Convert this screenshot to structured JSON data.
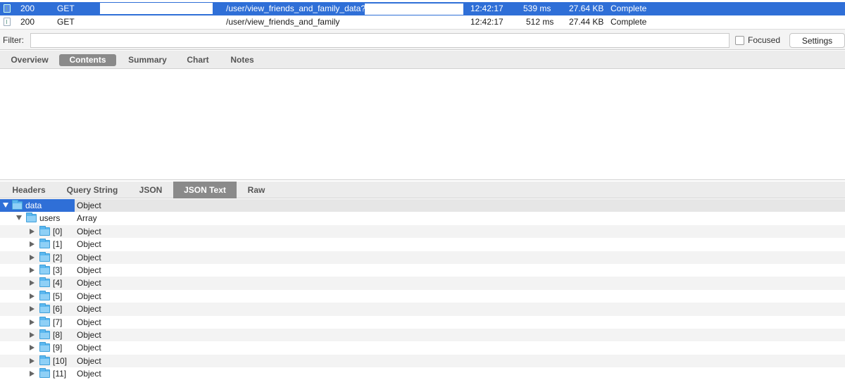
{
  "requests": [
    {
      "status": "200",
      "method": "GET",
      "path": "/user/view_friends_and_family_data?",
      "time": "12:42:17",
      "duration": "539 ms",
      "size": "27.64 KB",
      "state": "Complete"
    },
    {
      "status": "200",
      "method": "GET",
      "path": "/user/view_friends_and_family",
      "time": "12:42:17",
      "duration": "512 ms",
      "size": "27.44 KB",
      "state": "Complete"
    }
  ],
  "filter": {
    "label": "Filter:",
    "value": "",
    "focused_label": "Focused",
    "settings_label": "Settings"
  },
  "top_tabs": [
    "Overview",
    "Contents",
    "Summary",
    "Chart",
    "Notes"
  ],
  "bottom_tabs": [
    "Headers",
    "Query String",
    "JSON",
    "JSON Text",
    "Raw"
  ],
  "tree": {
    "root": {
      "key": "data",
      "type": "Object"
    },
    "users": {
      "key": "users",
      "type": "Array"
    },
    "items": [
      {
        "key": "[0]",
        "type": "Object"
      },
      {
        "key": "[1]",
        "type": "Object"
      },
      {
        "key": "[2]",
        "type": "Object"
      },
      {
        "key": "[3]",
        "type": "Object"
      },
      {
        "key": "[4]",
        "type": "Object"
      },
      {
        "key": "[5]",
        "type": "Object"
      },
      {
        "key": "[6]",
        "type": "Object"
      },
      {
        "key": "[7]",
        "type": "Object"
      },
      {
        "key": "[8]",
        "type": "Object"
      },
      {
        "key": "[9]",
        "type": "Object"
      },
      {
        "key": "[10]",
        "type": "Object"
      },
      {
        "key": "[11]",
        "type": "Object"
      }
    ]
  },
  "colors": {
    "selection": "#2f6fd7",
    "active_tab": "#8a8a8a",
    "folder": "#5bb7ef"
  }
}
